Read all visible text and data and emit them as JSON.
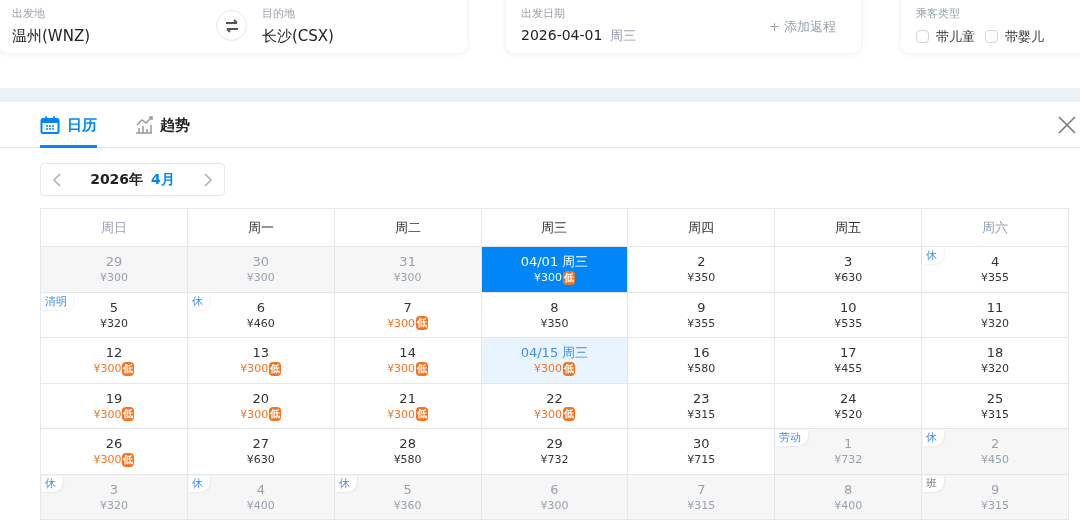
{
  "search": {
    "origin": {
      "label": "出发地",
      "value": "温州(WNZ)"
    },
    "destination": {
      "label": "目的地",
      "value": "长沙(CSX)"
    },
    "date": {
      "label": "出发日期",
      "value": "2026-04-01",
      "weekday": "周三",
      "return_link": "+ 添加返程"
    },
    "passengers": {
      "label": "乘客类型",
      "options": [
        {
          "label": "带儿童",
          "checked": false
        },
        {
          "label": "带婴儿",
          "checked": false
        }
      ]
    }
  },
  "tabs": [
    {
      "label": "日历",
      "selected": true
    },
    {
      "label": "趋势",
      "selected": false
    }
  ],
  "month_nav": {
    "year": "2026年",
    "month": "4月"
  },
  "weekdays": [
    {
      "label": "周日",
      "weekend": true
    },
    {
      "label": "周一",
      "weekend": false
    },
    {
      "label": "周二",
      "weekend": false
    },
    {
      "label": "周三",
      "weekend": false
    },
    {
      "label": "周四",
      "weekend": false
    },
    {
      "label": "周五",
      "weekend": false
    },
    {
      "label": "周六",
      "weekend": true
    }
  ],
  "days": [
    {
      "day": "29",
      "price": "¥300",
      "outside": true
    },
    {
      "day": "30",
      "price": "¥300",
      "outside": true
    },
    {
      "day": "31",
      "price": "¥300",
      "outside": true
    },
    {
      "day": "04/01 周三",
      "price": "¥300",
      "badge": "低",
      "low": true,
      "selected": true
    },
    {
      "day": "2",
      "price": "¥350"
    },
    {
      "day": "3",
      "price": "¥630"
    },
    {
      "day": "4",
      "price": "¥355",
      "tag": "休",
      "kind": "rest"
    },
    {
      "day": "5",
      "price": "¥320",
      "tag": "清明",
      "kind": "rest"
    },
    {
      "day": "6",
      "price": "¥460",
      "tag": "休",
      "kind": "rest"
    },
    {
      "day": "7",
      "price": "¥300",
      "badge": "低",
      "low": true
    },
    {
      "day": "8",
      "price": "¥350"
    },
    {
      "day": "9",
      "price": "¥355"
    },
    {
      "day": "10",
      "price": "¥535"
    },
    {
      "day": "11",
      "price": "¥320"
    },
    {
      "day": "12",
      "price": "¥300",
      "badge": "低",
      "low": true
    },
    {
      "day": "13",
      "price": "¥300",
      "badge": "低",
      "low": true
    },
    {
      "day": "14",
      "price": "¥300",
      "badge": "低",
      "low": true
    },
    {
      "day": "04/15 周三",
      "price": "¥300",
      "badge": "低",
      "low": true,
      "highlighted": true
    },
    {
      "day": "16",
      "price": "¥580"
    },
    {
      "day": "17",
      "price": "¥455"
    },
    {
      "day": "18",
      "price": "¥320"
    },
    {
      "day": "19",
      "price": "¥300",
      "badge": "低",
      "low": true
    },
    {
      "day": "20",
      "price": "¥300",
      "badge": "低",
      "low": true
    },
    {
      "day": "21",
      "price": "¥300",
      "badge": "低",
      "low": true
    },
    {
      "day": "22",
      "price": "¥300",
      "badge": "低",
      "low": true
    },
    {
      "day": "23",
      "price": "¥315"
    },
    {
      "day": "24",
      "price": "¥520"
    },
    {
      "day": "25",
      "price": "¥315"
    },
    {
      "day": "26",
      "price": "¥300",
      "badge": "低",
      "low": true
    },
    {
      "day": "27",
      "price": "¥630"
    },
    {
      "day": "28",
      "price": "¥580"
    },
    {
      "day": "29",
      "price": "¥732"
    },
    {
      "day": "30",
      "price": "¥715"
    },
    {
      "day": "1",
      "price": "¥732",
      "outside": true,
      "tag": "劳动",
      "kind": "rest"
    },
    {
      "day": "2",
      "price": "¥450",
      "outside": true,
      "tag": "休",
      "kind": "rest"
    },
    {
      "day": "3",
      "price": "¥320",
      "outside": true,
      "tag": "休",
      "kind": "rest"
    },
    {
      "day": "4",
      "price": "¥400",
      "outside": true,
      "tag": "休",
      "kind": "rest"
    },
    {
      "day": "5",
      "price": "¥360",
      "outside": true,
      "tag": "休",
      "kind": "rest"
    },
    {
      "day": "6",
      "price": "¥300",
      "outside": true
    },
    {
      "day": "7",
      "price": "¥315",
      "outside": true
    },
    {
      "day": "8",
      "price": "¥400",
      "outside": true
    },
    {
      "day": "9",
      "price": "¥315",
      "outside": true,
      "tag": "班",
      "kind": "work"
    }
  ]
}
